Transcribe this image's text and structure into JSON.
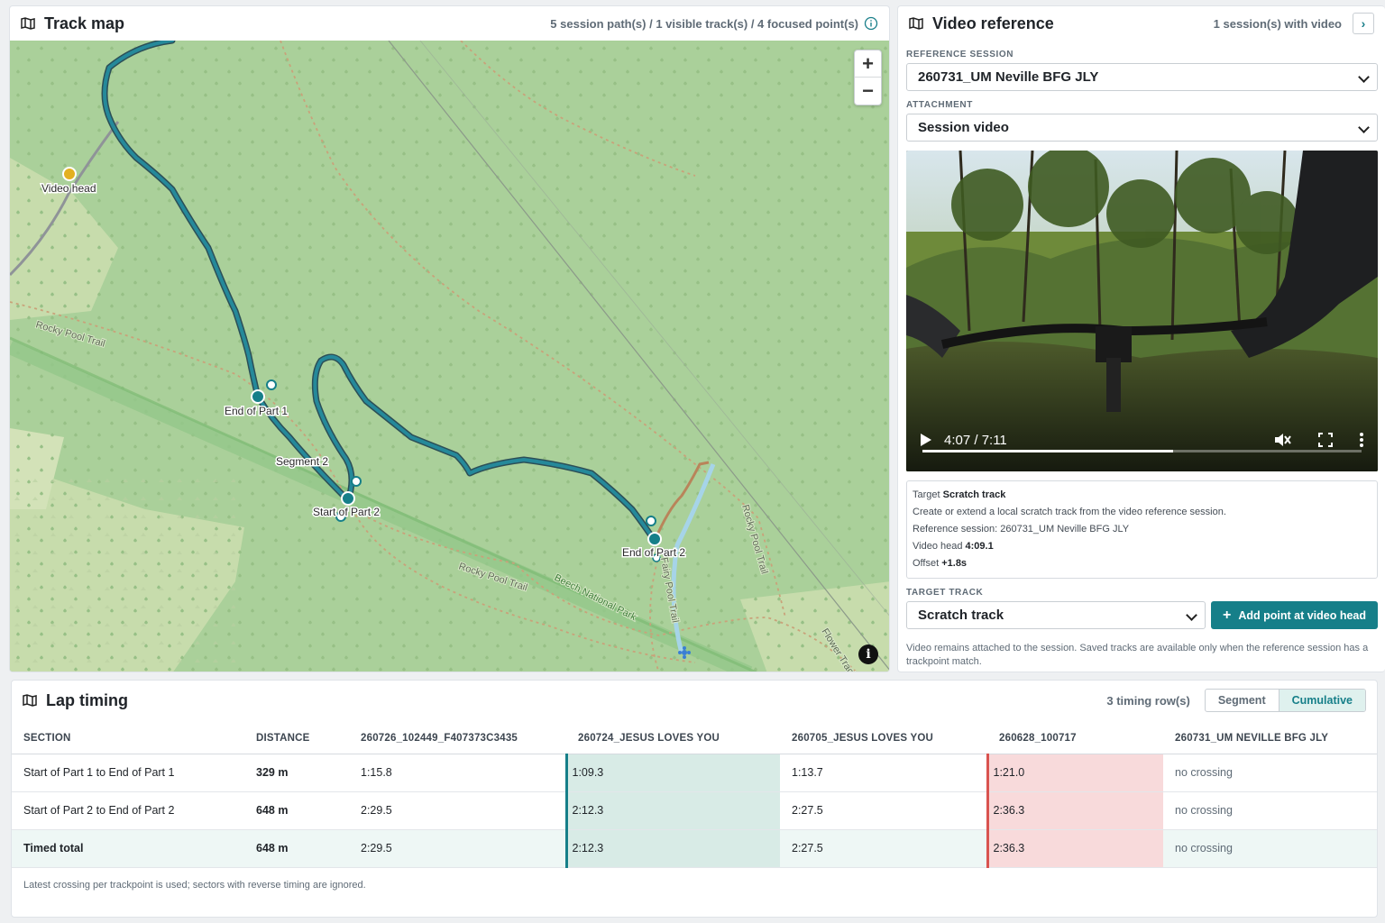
{
  "map_panel": {
    "title": "Track map",
    "meta": "5 session path(s) / 1 visible track(s) / 4 focused point(s)",
    "labels": {
      "video_head": "Video head",
      "end_part1": "End of Part 1",
      "segment2": "Segment 2",
      "start_part2": "Start of Part 2",
      "end_part2": "End of Part 2",
      "rocky_pool_trail_1": "Rocky Pool Trail",
      "rocky_pool_trail_2": "Rocky Pool Trail",
      "beech_np": "Beech National Park",
      "rocky_pool_trail_v": "Rocky Pool Trail",
      "fairy_pool_trail": "Fairy Pool Trail",
      "flower_track": "Flower Track"
    },
    "zoom_in": "+",
    "zoom_out": "−",
    "info": "i"
  },
  "video_panel": {
    "title": "Video reference",
    "meta": "1 session(s) with video",
    "nav": "›",
    "reference_session_label": "REFERENCE SESSION",
    "reference_session_value": "260731_UM Neville BFG JLY",
    "attachment_label": "ATTACHMENT",
    "attachment_value": "Session video",
    "player": {
      "time": "4:07 / 7:11",
      "progress": 0.57
    },
    "info": {
      "target_prefix": "Target",
      "target_value": "Scratch track",
      "description": "Create or extend a local scratch track from the video reference session.",
      "reference": "Reference session: 260731_UM Neville BFG JLY",
      "video_head_prefix": "Video head",
      "video_head_value": "4:09.1",
      "offset_prefix": "Offset",
      "offset_value": "+1.8s"
    },
    "target_track_label": "TARGET TRACK",
    "target_track_value": "Scratch track",
    "add_button": "Add point at video head",
    "footnote": "Video remains attached to the session. Saved tracks are available only when the reference session has a trackpoint match."
  },
  "lap_panel": {
    "title": "Lap timing",
    "meta": "3 timing row(s)",
    "toggle": {
      "segment": "Segment",
      "cumulative": "Cumulative"
    },
    "columns": [
      "SECTION",
      "DISTANCE",
      "260726_102449_F407373C3435",
      "260724_JESUS LOVES YOU",
      "260705_JESUS LOVES YOU",
      "260628_100717",
      "260731_UM NEVILLE BFG JLY"
    ],
    "rows": [
      [
        "Start of Part 1 to End of Part 1",
        "329 m",
        "1:15.8",
        "1:09.3",
        "1:13.7",
        "1:21.0",
        "no crossing"
      ],
      [
        "Start of Part 2 to End of Part 2",
        "648 m",
        "2:29.5",
        "2:12.3",
        "2:27.5",
        "2:36.3",
        "no crossing"
      ],
      [
        "Timed total",
        "648 m",
        "2:29.5",
        "2:12.3",
        "2:27.5",
        "2:36.3",
        "no crossing"
      ]
    ],
    "note": "Latest crossing per trackpoint is used; sectors with reverse timing are ignored."
  },
  "colors": {
    "accent": "#167f89",
    "best": "#d8ebe6",
    "worst": "#f8dadb",
    "map_bg": "#aad09a"
  }
}
